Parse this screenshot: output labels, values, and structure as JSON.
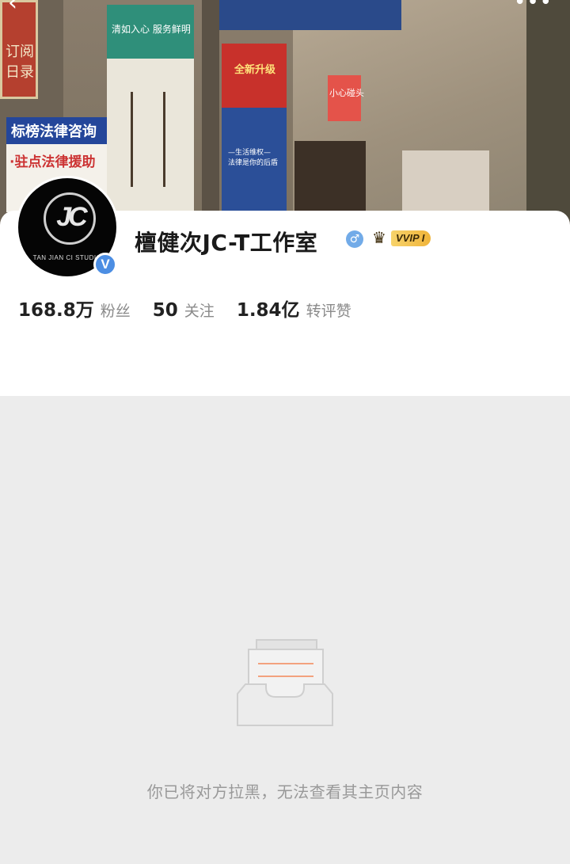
{
  "header": {
    "back_icon": "chevron-left-icon",
    "more_icon": "more-dots-icon",
    "cover_signs": {
      "left_red": "订阅\n日录",
      "legal": "标榜法律咨询",
      "legal_sub": "·驻点法律援助",
      "green_poster": "清如入心 服务鲜明",
      "red_poster": "全新升级",
      "blue_poster": "—生活维权—\n法律是你的后盾",
      "caution": "小心碰头"
    }
  },
  "profile": {
    "name": "檀健次JC-T工作室",
    "avatar_monogram": "JC",
    "avatar_text": "TAN JIAN CI STUDIO",
    "verified_icon": "verified-v-icon",
    "gender_icon": "male-icon",
    "vip_label": "VVIP I",
    "vip_icon": "crown-icon",
    "stats": [
      {
        "value": "168.8万",
        "label": "粉丝"
      },
      {
        "value": "50",
        "label": "关注"
      },
      {
        "value": "1.84亿",
        "label": "转评赞"
      }
    ]
  },
  "blocked": {
    "icon": "empty-box-icon",
    "message": "你已将对方拉黑，无法查看其主页内容"
  },
  "colors": {
    "verified": "#4c8ee3",
    "gender": "#72abe8",
    "vip_gold": "#f0b43a",
    "empty_line": "#f3a27e"
  }
}
